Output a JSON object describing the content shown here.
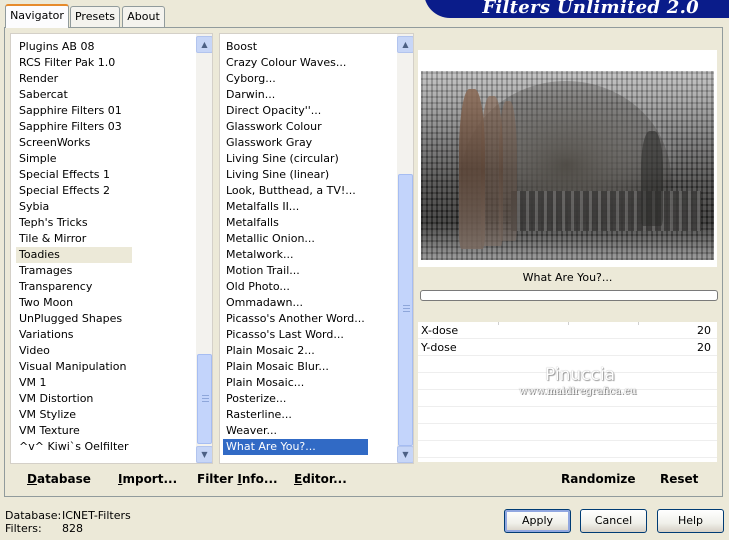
{
  "window": {
    "title_banner": "Filters Unlimited 2.0",
    "accent": "#0a1c8a"
  },
  "tabs": [
    {
      "label": "Navigator",
      "active": true
    },
    {
      "label": "Presets",
      "active": false
    },
    {
      "label": "About",
      "active": false
    }
  ],
  "categories": {
    "items": [
      "Plugins AB 08",
      "RCS Filter Pak 1.0",
      "Render",
      "Sabercat",
      "Sapphire Filters 01",
      "Sapphire Filters 03",
      "ScreenWorks",
      "Simple",
      "Special Effects 1",
      "Special Effects 2",
      "Sybia",
      "Teph's Tricks",
      "Tile & Mirror",
      "Toadies",
      "Tramages",
      "Transparency",
      "Two Moon",
      "UnPlugged Shapes",
      "Variations",
      "Video",
      "Visual Manipulation",
      "VM 1",
      "VM Distortion",
      "VM Stylize",
      "VM Texture",
      "^v^ Kiwi`s Oelfilter"
    ],
    "highlighted": "Toadies"
  },
  "filters": {
    "items": [
      "Boost",
      "Crazy Colour Waves...",
      "Cyborg...",
      "Darwin...",
      "Direct Opacity''...",
      "Glasswork Colour",
      "Glasswork Gray",
      "Living Sine (circular)",
      "Living Sine (linear)",
      "Look, Butthead, a TV!...",
      "Metalfalls II...",
      "Metalfalls",
      "Metallic Onion...",
      "Metalwork...",
      "Motion Trail...",
      "Old Photo...",
      "Ommadawn...",
      "Picasso's Another Word...",
      "Picasso's Last Word...",
      "Plain Mosaic 2...",
      "Plain Mosaic Blur...",
      "Plain Mosaic...",
      "Posterize...",
      "Rasterline...",
      "Weaver...",
      "What Are You?..."
    ],
    "selected": "What Are You?..."
  },
  "left_buttons": {
    "database": {
      "u": "D",
      "rest": "atabase"
    },
    "import": {
      "u": "I",
      "rest": "mport..."
    },
    "filter_info": {
      "pre": "Filter ",
      "u": "I",
      "rest": "nfo..."
    },
    "editor": {
      "u": "E",
      "rest": "ditor..."
    }
  },
  "preview": {
    "filter_name": "What Are You?...",
    "progress": 0
  },
  "params": [
    {
      "label": "X-dose",
      "value": "20"
    },
    {
      "label": "Y-dose",
      "value": "20"
    }
  ],
  "watermark": {
    "name": "Pinuccia",
    "url": "www.maidiregrafica.eu"
  },
  "right_buttons": {
    "randomize": "Randomize",
    "reset": "Reset"
  },
  "status": {
    "database_label": "Database:",
    "database_value": "ICNET-Filters",
    "filters_label": "Filters:",
    "filters_value": "828"
  },
  "dialog_buttons": {
    "apply": "Apply",
    "cancel": "Cancel",
    "help": "Help"
  }
}
